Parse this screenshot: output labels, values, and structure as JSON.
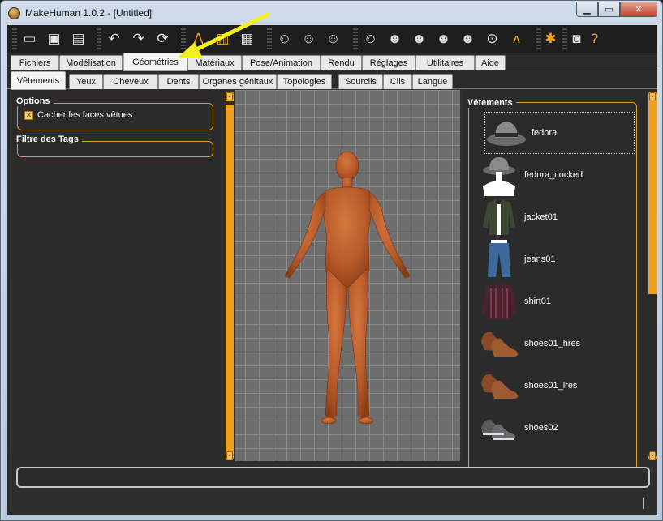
{
  "window": {
    "title": "MakeHuman 1.0.2 - [Untitled]"
  },
  "toolbar": {
    "buttons": [
      {
        "name": "new-icon",
        "glyph": "▭"
      },
      {
        "name": "save-icon",
        "glyph": "▣"
      },
      {
        "name": "export-icon",
        "glyph": "▤"
      },
      {
        "name": "undo-icon",
        "glyph": "↶"
      },
      {
        "name": "redo-icon",
        "glyph": "↷"
      },
      {
        "name": "reset-icon",
        "glyph": "⟳"
      },
      {
        "name": "wireframe-icon",
        "glyph": "⋀"
      },
      {
        "name": "background-icon",
        "glyph": "▥"
      },
      {
        "name": "smooth-icon",
        "glyph": "▦"
      },
      {
        "name": "front-view-icon",
        "glyph": "☺"
      },
      {
        "name": "back-view-icon",
        "glyph": "☺"
      },
      {
        "name": "left-view-icon",
        "glyph": "☺"
      },
      {
        "name": "right-view-icon",
        "glyph": "☺"
      },
      {
        "name": "top-view-icon",
        "glyph": "☻"
      },
      {
        "name": "bottom-view-icon",
        "glyph": "☻"
      },
      {
        "name": "left-side-icon",
        "glyph": "☻"
      },
      {
        "name": "right-side-icon",
        "glyph": "☻"
      },
      {
        "name": "reset-camera-icon",
        "glyph": "⊙"
      },
      {
        "name": "pose-icon",
        "glyph": "ᴧ"
      },
      {
        "name": "symmetry-icon",
        "glyph": "✱"
      },
      {
        "name": "screenshot-icon",
        "glyph": "◙"
      },
      {
        "name": "help-icon",
        "glyph": "?"
      }
    ]
  },
  "tabs": [
    {
      "label": "Fichiers"
    },
    {
      "label": "Modélisation"
    },
    {
      "label": "Géométries",
      "active": true
    },
    {
      "label": "Matériaux"
    },
    {
      "label": "Pose/Animation"
    },
    {
      "label": "Rendu"
    },
    {
      "label": "Réglages"
    },
    {
      "label": "Utilitaires"
    },
    {
      "label": "Aide"
    }
  ],
  "subtabs": [
    {
      "label": "Vêtements",
      "active": true
    },
    {
      "label": "Yeux"
    },
    {
      "label": "Cheveux"
    },
    {
      "label": "Dents"
    },
    {
      "label": "Organes génitaux"
    },
    {
      "label": "Topologies"
    },
    {
      "label": "Sourcils"
    },
    {
      "label": "Cils"
    },
    {
      "label": "Langue"
    }
  ],
  "left": {
    "options_title": "Options",
    "hide_faces_label": "Cacher les faces vêtues",
    "hide_faces_checked": true,
    "tags_title": "Filtre des Tags"
  },
  "right": {
    "title": "Vêtements",
    "items": [
      {
        "label": "fedora",
        "icon": "fedora-icon",
        "selected": true
      },
      {
        "label": "fedora_cocked",
        "icon": "fedora-cocked-icon"
      },
      {
        "label": "jacket01",
        "icon": "jacket-icon"
      },
      {
        "label": "jeans01",
        "icon": "jeans-icon"
      },
      {
        "label": "shirt01",
        "icon": "shirt-icon"
      },
      {
        "label": "shoes01_hres",
        "icon": "shoes-icon"
      },
      {
        "label": "shoes01_lres",
        "icon": "shoes-icon"
      },
      {
        "label": "shoes02",
        "icon": "sneakers-icon"
      }
    ]
  },
  "colors": {
    "accent": "#f0a020",
    "skin": "#c0602e",
    "annotation": "#f4f020"
  }
}
